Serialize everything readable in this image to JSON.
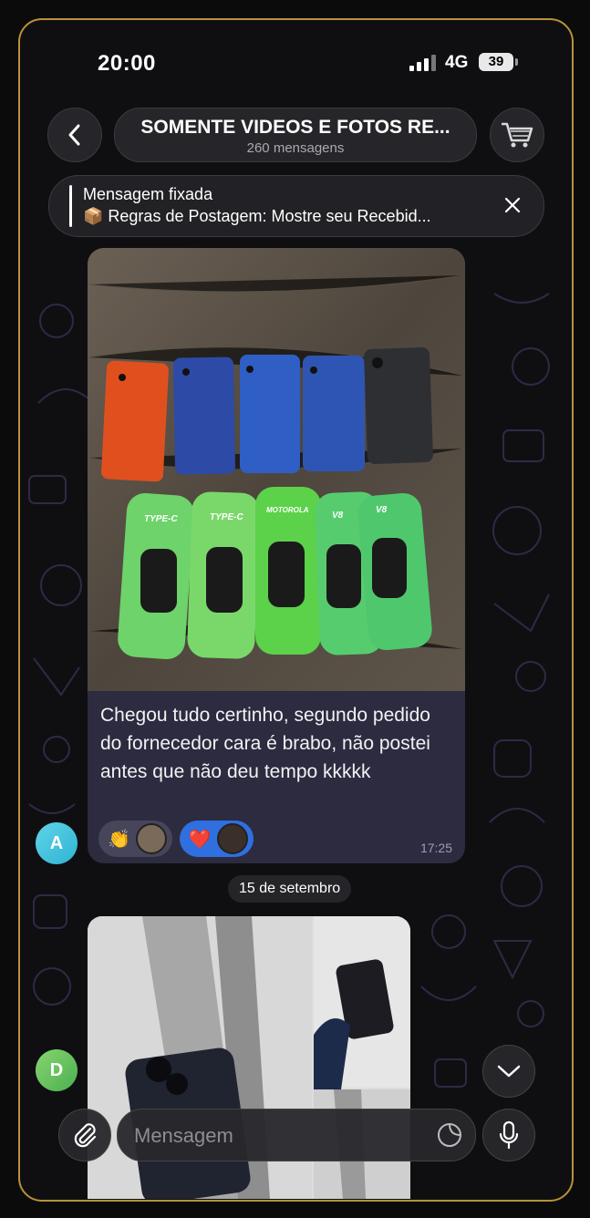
{
  "status_bar": {
    "time": "20:00",
    "network": "4G",
    "battery": "39"
  },
  "header": {
    "back_icon": "chevron-left-icon",
    "title": "SOMENTE VIDEOS E FOTOS RE...",
    "subtitle": "260 mensagens",
    "cart_icon": "shopping-cart-icon"
  },
  "pinned": {
    "label": "Mensagem fixada",
    "text": "📦 Regras de Postagem: Mostre seu Recebid...",
    "close_icon": "close-icon"
  },
  "messages": [
    {
      "avatar_letter": "A",
      "text": "Chegou tudo certinho, segundo pedido do fornecedor cara é brabo, não postei antes que não deu tempo kkkkk",
      "time": "17:25",
      "reactions": [
        {
          "emoji": "👏"
        },
        {
          "emoji": "❤️"
        }
      ],
      "photo_labels": [
        "TYPE-C",
        "TYPE-C",
        "MOTOROLA",
        "V8",
        "V8"
      ]
    },
    {
      "avatar_letter": "D"
    }
  ],
  "date_separator": "15 de setembro",
  "composer": {
    "placeholder": "Mensagem",
    "attach_icon": "paperclip-icon",
    "sticker_icon": "sticker-icon",
    "mic_icon": "microphone-icon"
  },
  "colors": {
    "frame_border": "#b8923a",
    "bubble": "#2c2b40",
    "reaction_active": "#2f6fe0"
  }
}
